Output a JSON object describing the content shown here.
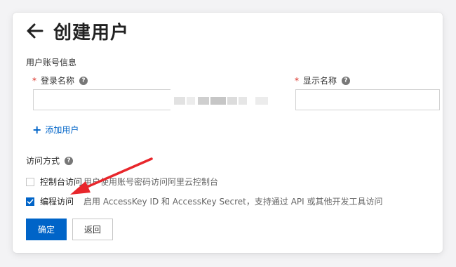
{
  "page": {
    "title": "创建用户",
    "back_icon": "arrow-left-icon"
  },
  "account_info": {
    "section_title": "用户账号信息",
    "login_name": {
      "required_mark": "*",
      "label": "登录名称",
      "help_icon": "question-circle-icon",
      "value": ""
    },
    "display_name": {
      "required_mark": "*",
      "label": "显示名称",
      "help_icon": "question-circle-icon",
      "value": ""
    },
    "add_user_label": "添加用户",
    "add_user_icon": "plus-icon"
  },
  "access": {
    "section_title": "访问方式",
    "help_icon": "question-circle-icon",
    "options": [
      {
        "label": "控制台访问",
        "description": "用户使用账号密码访问阿里云控制台",
        "checked": false
      },
      {
        "label": "编程访问",
        "description": "启用 AccessKey ID 和 AccessKey Secret，支持通过 API 或其他开发工具访问",
        "checked": true
      }
    ]
  },
  "buttons": {
    "confirm_label": "确定",
    "back_label": "返回"
  },
  "colors": {
    "accent": "#0064c8",
    "required": "#d93026",
    "annotation_arrow": "#e8262b"
  }
}
